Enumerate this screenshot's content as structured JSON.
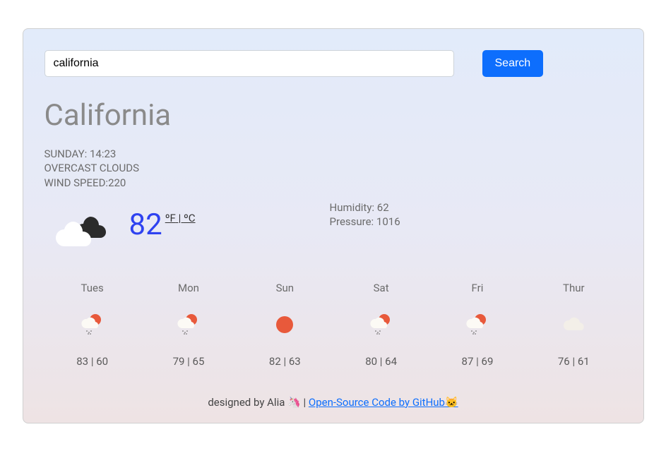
{
  "search": {
    "value": "california",
    "button_label": "Search"
  },
  "city": "California",
  "summary": {
    "day_time": "Sunday: 14:23",
    "description": "overcast clouds",
    "wind_label": "Wind Speed:",
    "wind_value": "220"
  },
  "current": {
    "temperature": "82",
    "unit_f": "ºF",
    "unit_sep": " | ",
    "unit_c": "ºC",
    "humidity_label": "Humidity: ",
    "humidity_value": "62",
    "pressure_label": "Pressure: ",
    "pressure_value": "1016"
  },
  "forecast": [
    {
      "day": "Tues",
      "high": "83",
      "low": "60",
      "icon": "rain-sun"
    },
    {
      "day": "Mon",
      "high": "79",
      "low": "65",
      "icon": "rain-sun"
    },
    {
      "day": "Sun",
      "high": "82",
      "low": "63",
      "icon": "sun"
    },
    {
      "day": "Sat",
      "high": "80",
      "low": "64",
      "icon": "rain-sun"
    },
    {
      "day": "Fri",
      "high": "87",
      "low": "69",
      "icon": "rain-sun"
    },
    {
      "day": "Thur",
      "high": "76",
      "low": "61",
      "icon": "cloud"
    }
  ],
  "footer": {
    "credit": "designed by Alia 🦄 | ",
    "link_text": "Open-Source Code by GitHub🐱"
  }
}
